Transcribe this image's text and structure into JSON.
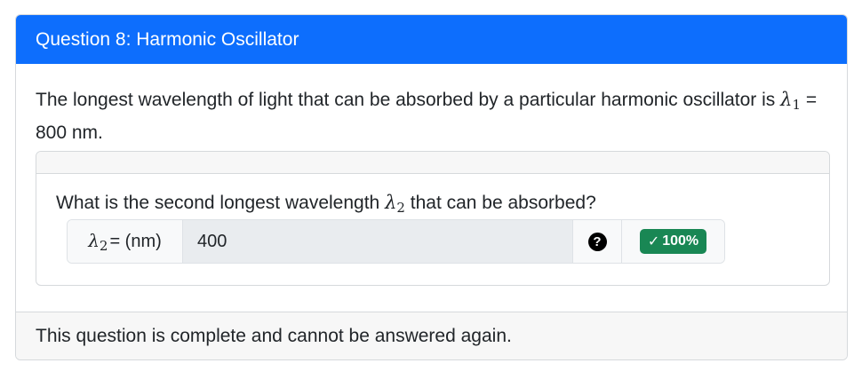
{
  "question": {
    "title": "Question 8: Harmonic Oscillator",
    "prompt_before": "The longest wavelength of light that can be absorbed by a particular harmonic oscillator is ",
    "prompt_symbol": "λ",
    "prompt_subscript": "1",
    "prompt_after": " = 800 nm."
  },
  "part": {
    "question_before": "What is the second longest wavelength ",
    "question_symbol": "λ",
    "question_subscript": "2",
    "question_after": " that can be absorbed?",
    "input_label_symbol": "λ",
    "input_label_subscript": "2",
    "input_label_suffix": "= (nm)",
    "input_value": "400",
    "help_icon": "question-circle-icon",
    "help_glyph": "?",
    "score_icon": "check-icon",
    "score_glyph": "✓",
    "score_text": "100%"
  },
  "footer": {
    "message": "This question is complete and cannot be answered again."
  },
  "colors": {
    "header_bg": "#0d6efd",
    "badge_bg": "#198754",
    "input_bg": "#e9ecef"
  }
}
